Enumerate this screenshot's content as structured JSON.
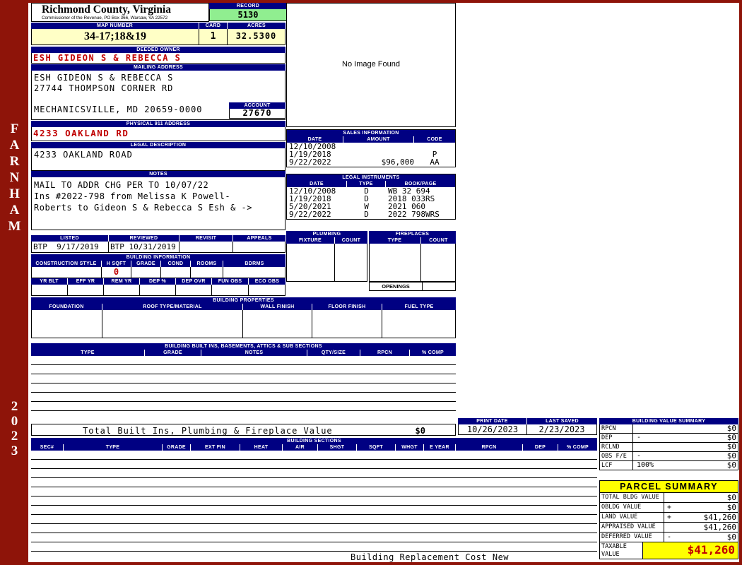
{
  "colors": {
    "header_bar_navy": "#000082",
    "record_green": "#90ee90",
    "value_yellow": "#ffffc6",
    "highlight_yellow": "#ffff00",
    "alert_red": "#c00000",
    "sidebar_maroon": "#8e1409"
  },
  "sidebar": {
    "district": "FARNHAM",
    "year": "2023"
  },
  "header": {
    "county": "Richmond County, Virginia",
    "sub": "Commissioner of the Revenue, PO Box 366, Warsaw, VA 22572",
    "record_label": "RECORD",
    "record_value": "5130",
    "map_number_label": "MAP NUMBER",
    "map_number": "34-17;18&19",
    "card_label": "CARD",
    "card": "1",
    "acres_label": "ACRES",
    "acres": "32.5300"
  },
  "owner": {
    "deeded_owner_label": "DEEDED OWNER",
    "deeded_owner": "ESH GIDEON S & REBECCA S",
    "mailing_address_label": "MAILING ADDRESS",
    "mailing_lines": [
      "ESH GIDEON S & REBECCA S",
      "27744 THOMPSON CORNER RD",
      "",
      "MECHANICSVILLE, MD 20659-0000"
    ],
    "account_label": "ACCOUNT",
    "account": "27670",
    "physical_address_label": "PHYSICAL 911 ADDRESS",
    "physical_address": "4233 OAKLAND RD",
    "legal_description_label": "LEGAL DESCRIPTION",
    "legal_description": "4233 OAKLAND ROAD",
    "notes_label": "NOTES",
    "notes_lines": [
      "MAIL TO ADDR CHG PER TO 10/07/22",
      "Ins #2022-798 from Melissa K Powell-",
      "Roberts to Gideon S & Rebecca S Esh & ->"
    ]
  },
  "image_box": {
    "text": "No Image Found"
  },
  "sales": {
    "title": "SALES INFORMATION",
    "columns": [
      "DATE",
      "AMOUNT",
      "CODE"
    ],
    "rows": [
      {
        "date": "12/10/2008",
        "amount": "",
        "code": ""
      },
      {
        "date": "1/19/2018",
        "amount": "",
        "code": "P"
      },
      {
        "date": "9/22/2022",
        "amount": "$96,000",
        "code": "AA"
      }
    ]
  },
  "legal_instruments": {
    "title": "LEGAL INSTRUMENTS",
    "columns": [
      "DATE",
      "TYPE",
      "BOOK/PAGE"
    ],
    "rows": [
      {
        "date": "12/10/2008",
        "type": "D",
        "book": "WB 32 694"
      },
      {
        "date": "1/19/2018",
        "type": "D",
        "book": "2018 033RS"
      },
      {
        "date": "5/20/2021",
        "type": "W",
        "book": "2021 060"
      },
      {
        "date": "9/22/2022",
        "type": "D",
        "book": "2022 798WRS"
      }
    ]
  },
  "plumbing": {
    "title": "PLUMBING",
    "columns": [
      "FIXTURE",
      "COUNT"
    ]
  },
  "fireplaces": {
    "title": "FIREPLACES",
    "columns": [
      "TYPE",
      "COUNT"
    ],
    "openings_label": "OPENINGS"
  },
  "review": {
    "listed_label": "LISTED",
    "listed": "BTP  9/17/2019",
    "reviewed_label": "REVIEWED",
    "reviewed": "BTP 10/31/2019",
    "revisit_label": "REVISIT",
    "revisit": "",
    "appeals_label": "APPEALS",
    "appeals": ""
  },
  "building_info": {
    "title": "BUILDING INFORMATION",
    "row1_headers": [
      "CONSTRUCTION STYLE",
      "H SQFT",
      "GRADE",
      "COND",
      "ROOMS",
      "BDRMS"
    ],
    "h_sqft": "0",
    "row2_headers": [
      "YR BLT",
      "EFF YR",
      "REM YR",
      "DEP %",
      "DEP OVR",
      "FUN OBS",
      "ECO OBS"
    ]
  },
  "building_properties": {
    "title": "BUILDING PROPERTIES",
    "columns": [
      "FOUNDATION",
      "ROOF TYPE/MATERIAL",
      "WALL FINISH",
      "FLOOR FINISH",
      "FUEL TYPE"
    ]
  },
  "built_ins": {
    "title": "BUILDING BUILT INS, BASEMENTS, ATTICS & SUB SECTIONS",
    "columns": [
      "TYPE",
      "GRADE",
      "NOTES",
      "QTY/SIZE",
      "RPCN",
      "% COMP"
    ],
    "total_label": "Total Built Ins, Plumbing & Fireplace Value",
    "total_value": "$0"
  },
  "dates": {
    "print_date_label": "PRINT DATE",
    "print_date": "10/26/2023",
    "last_saved_label": "LAST SAVED",
    "last_saved": "2/23/2023"
  },
  "building_value_summary": {
    "title": "BUILDING VALUE SUMMARY",
    "rows": [
      {
        "label": "RPCN",
        "op": "",
        "value": "$0"
      },
      {
        "label": "DEP",
        "op": "-",
        "value": "$0"
      },
      {
        "label": "RCLND",
        "op": "",
        "value": "$0"
      },
      {
        "label": "OBS F/E",
        "op": "-",
        "value": "$0"
      },
      {
        "label": "LCF",
        "op": "100%",
        "value": "$0"
      }
    ]
  },
  "building_sections": {
    "title": "BUILDING SECTIONS",
    "columns": [
      "SEC#",
      "TYPE",
      "GRADE",
      "EXT FIN",
      "HEAT",
      "AIR",
      "SHGT",
      "SQFT",
      "WHGT",
      "E YEAR",
      "RPCN",
      "DEP",
      "% COMP"
    ]
  },
  "parcel_summary": {
    "title": "PARCEL SUMMARY",
    "rows": [
      {
        "label": "TOTAL BLDG VALUE",
        "op": "",
        "value": "$0"
      },
      {
        "label": "OBLDG VALUE",
        "op": "+",
        "value": "$0"
      },
      {
        "label": "LAND VALUE",
        "op": "+",
        "value": "$41,260"
      },
      {
        "label": "APPRAISED VALUE",
        "op": "",
        "value": "$41,260"
      },
      {
        "label": "DEFERRED VALUE",
        "op": "-",
        "value": "$0"
      }
    ],
    "taxable_label": "TAXABLE VALUE",
    "taxable_value": "$41,260"
  },
  "footer": {
    "text": "Building Replacement Cost New"
  }
}
